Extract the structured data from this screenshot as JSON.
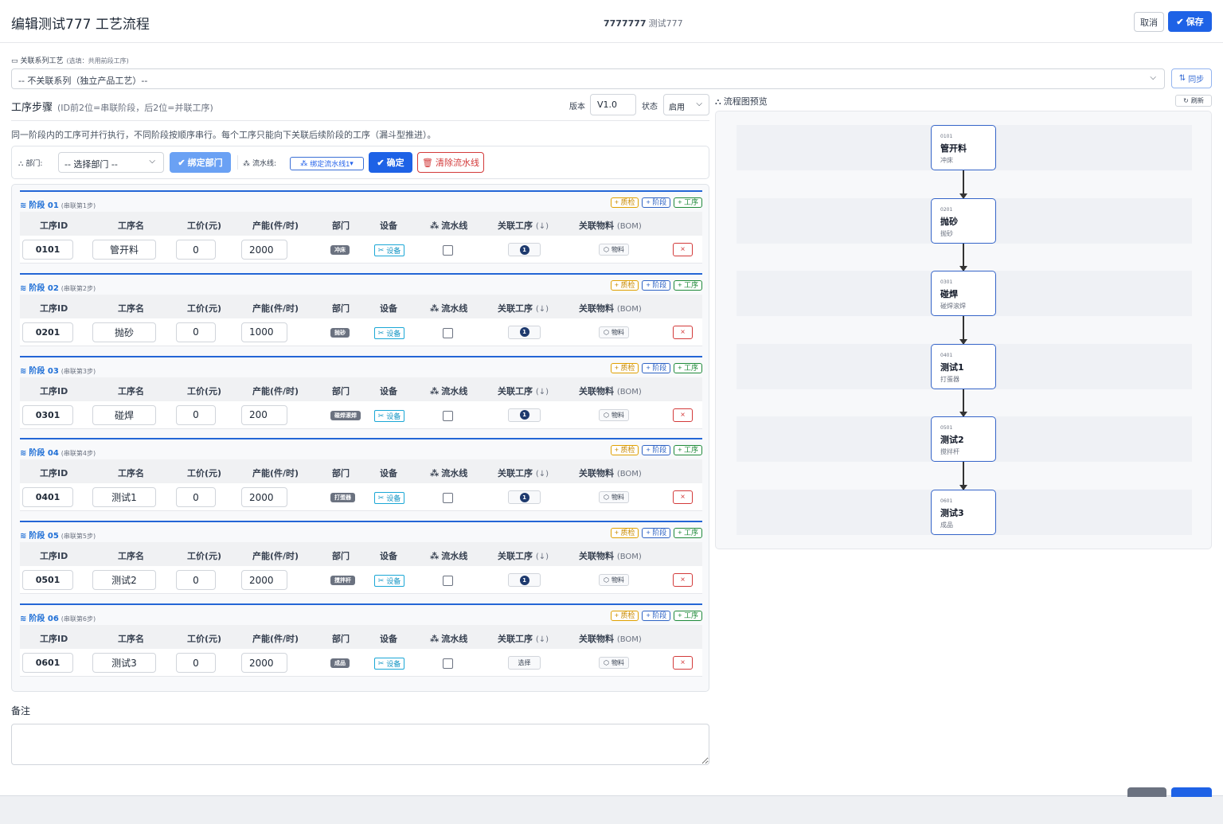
{
  "header": {
    "title": "编辑测试777 工艺流程",
    "product_code": "7777777",
    "product_name": "测试777",
    "cancel_label": "取消",
    "save_label": "保存"
  },
  "series": {
    "label": "关联系列工艺",
    "hint": "(选填：共用前段工序)",
    "selected": "-- 不关联系列（独立产品工艺）--",
    "sync_label": "同步"
  },
  "steps": {
    "title": "工序步骤",
    "hint": "(ID前2位=串联阶段，后2位=并联工序)",
    "version_label": "版本",
    "version_value": "V1.0",
    "state_label": "状态",
    "state_value": "启用",
    "description": "同一阶段内的工序可并行执行，不同阶段按顺序串行。每个工序只能向下关联后续阶段的工序（漏斗型推进）。"
  },
  "toolbar": {
    "dept_label": "部门:",
    "dept_placeholder": "-- 选择部门 --",
    "bind_dept_label": "绑定部门",
    "line_label": "流水线:",
    "line_pick_label": "绑定流水线1",
    "confirm_label": "确定",
    "clear_line_label": "清除流水线"
  },
  "columns": {
    "id": "工序ID",
    "name": "工序名",
    "price": "工价(元)",
    "capacity": "产能(件/时)",
    "dept": "部门",
    "equip": "设备",
    "line": "流水线",
    "link": "关联工序",
    "link_hint": "(↓)",
    "bom": "关联物料",
    "bom_hint": "(BOM)"
  },
  "stage_actions": {
    "qc": "+ 质检",
    "stage": "+ 阶段",
    "proc": "+ 工序"
  },
  "row_labels": {
    "equip": "设备",
    "bom": "物料",
    "delete": "×",
    "select": "选择"
  },
  "stages": [
    {
      "title": "阶段 01",
      "sub": "(串联第1步)",
      "row": {
        "id": "0101",
        "name": "管开料",
        "price": "0",
        "capacity": "2000",
        "dept": "冲床",
        "link_count": "1"
      }
    },
    {
      "title": "阶段 02",
      "sub": "(串联第2步)",
      "row": {
        "id": "0201",
        "name": "抛砂",
        "price": "0",
        "capacity": "1000",
        "dept": "抛砂",
        "link_count": "1"
      }
    },
    {
      "title": "阶段 03",
      "sub": "(串联第3步)",
      "row": {
        "id": "0301",
        "name": "碰焊",
        "price": "0",
        "capacity": "200",
        "dept": "碰焊滚焊",
        "link_count": "1"
      }
    },
    {
      "title": "阶段 04",
      "sub": "(串联第4步)",
      "row": {
        "id": "0401",
        "name": "测试1",
        "price": "0",
        "capacity": "2000",
        "dept": "打蛋器",
        "link_count": "1"
      }
    },
    {
      "title": "阶段 05",
      "sub": "(串联第5步)",
      "row": {
        "id": "0501",
        "name": "测试2",
        "price": "0",
        "capacity": "2000",
        "dept": "搅拌杆",
        "link_count": "1"
      }
    },
    {
      "title": "阶段 06",
      "sub": "(串联第6步)",
      "row": {
        "id": "0601",
        "name": "测试3",
        "price": "0",
        "capacity": "2000",
        "dept": "成品",
        "link_count": ""
      }
    }
  ],
  "notes": {
    "label": "备注",
    "value": ""
  },
  "preview": {
    "title": "流程图预览",
    "refresh_label": "刷新",
    "nodes": [
      {
        "id": "0101",
        "name": "管开料",
        "dept": "冲床"
      },
      {
        "id": "0201",
        "name": "抛砂",
        "dept": "抛砂"
      },
      {
        "id": "0301",
        "name": "碰焊",
        "dept": "碰焊滚焊"
      },
      {
        "id": "0401",
        "name": "测试1",
        "dept": "打蛋器"
      },
      {
        "id": "0501",
        "name": "测试2",
        "dept": "搅拌杆"
      },
      {
        "id": "0601",
        "name": "测试3",
        "dept": "成品"
      }
    ]
  },
  "colors": {
    "primary": "#1e62e6",
    "stage_accent": "#2466d6",
    "danger": "#d33a3a",
    "qc": "#e0a000",
    "proc": "#1f8a3a",
    "node_border": "#3564c8"
  }
}
